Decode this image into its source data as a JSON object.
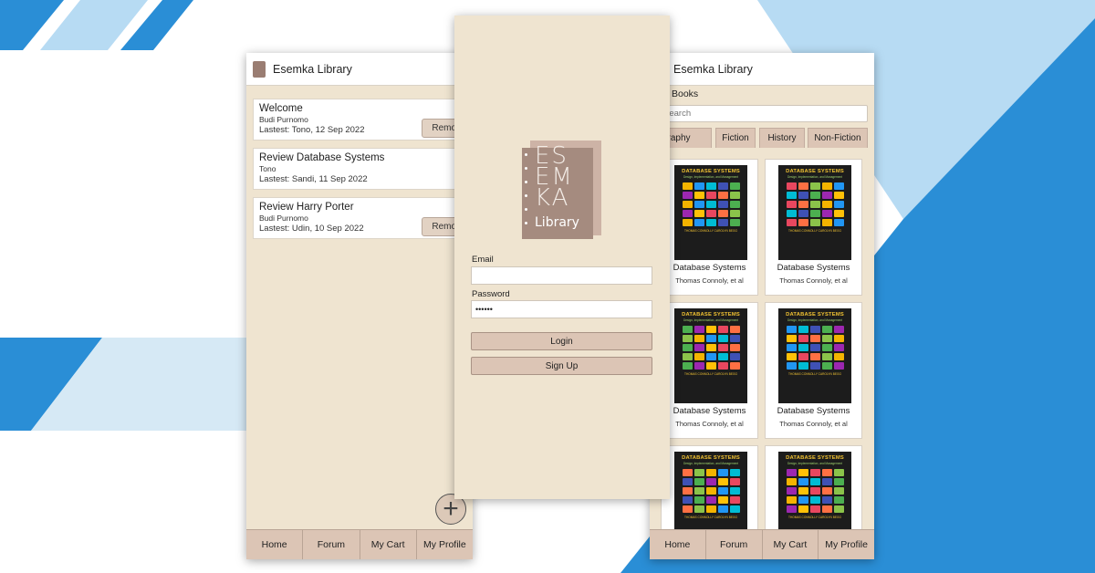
{
  "colors": {
    "brand_brown": "#9a7d72",
    "beige_bg": "#efe4d0",
    "button_tan": "#dcc5b5",
    "bg_blue": "#2a8ed6",
    "bg_light_blue": "#b7dbf3"
  },
  "forum_screen": {
    "title": "Esemka Library",
    "posts": [
      {
        "title": "Welcome",
        "author": "Budi Purnomo",
        "latest": "Lastest: Tono, 12 Sep 2022",
        "remove_label": "Remove",
        "has_remove": true
      },
      {
        "title": "Review Database Systems",
        "author": "Tono",
        "latest": "Lastest: Sandi, 11 Sep 2022",
        "remove_label": "",
        "has_remove": false
      },
      {
        "title": "Review Harry Porter",
        "author": "Budi Purnomo",
        "latest": "Lastest: Udin, 10 Sep 2022",
        "remove_label": "Remove",
        "has_remove": true
      }
    ],
    "add_icon": "plus-icon",
    "nav": [
      "Home",
      "Forum",
      "My Cart",
      "My Profile"
    ]
  },
  "login_screen": {
    "logo_letters": [
      "ES",
      "EM",
      "KA"
    ],
    "logo_sub": "Library",
    "email_label": "Email",
    "email_value": "",
    "password_label": "Password",
    "password_value": "••••••",
    "login_label": "Login",
    "signup_label": "Sign Up"
  },
  "books_screen": {
    "title": "Esemka Library",
    "section": "Books",
    "search_placeholder": "Search",
    "tabs": [
      "Biography",
      "Fiction",
      "History",
      "Non-Fiction"
    ],
    "cover": {
      "title": "DATABASE SYSTEMS",
      "subtitle": "Design, Implementation, and Management",
      "authors": "THOMAS CONNOLLY  CAROLYN BEGG"
    },
    "books": [
      {
        "title": "Database Systems",
        "author": "Thomas Connoly, et al"
      },
      {
        "title": "Database Systems",
        "author": "Thomas Connoly, et al"
      },
      {
        "title": "Database Systems",
        "author": "Thomas Connoly, et al"
      },
      {
        "title": "Database Systems",
        "author": "Thomas Connoly, et al"
      },
      {
        "title": "Database Systems",
        "author": "Thomas Connoly, et al"
      },
      {
        "title": "Database Systems",
        "author": "Thomas Connoly, et al"
      }
    ],
    "nav": [
      "Home",
      "Forum",
      "My Cart",
      "My Profile"
    ]
  }
}
